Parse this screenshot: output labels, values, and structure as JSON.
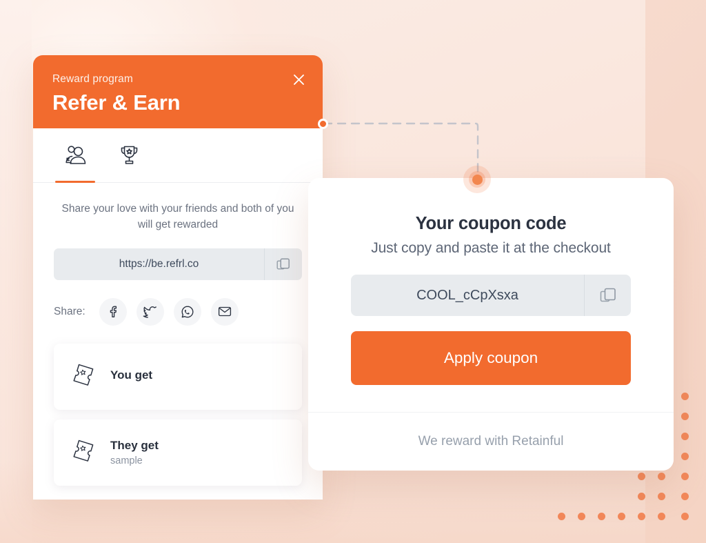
{
  "colors": {
    "brand_orange": "#f26b2e",
    "dot_orange": "#f2885a",
    "bg_peach": "#f8ddd1",
    "text_dark": "#2b3240",
    "text_muted": "#6b7280",
    "field_bg": "#e8ebee"
  },
  "widget": {
    "header": {
      "kicker": "Reward program",
      "title": "Refer & Earn",
      "close_label": "×",
      "close_icon": "close-icon"
    },
    "tabs": [
      {
        "id": "refer",
        "icon": "people-referral-icon",
        "label": "Refer",
        "active": true
      },
      {
        "id": "rewards",
        "icon": "trophy-icon",
        "label": "Rewards",
        "active": false
      }
    ],
    "body": {
      "blurb": "Share your love with your friends and both of you will get rewarded",
      "referral_link": "https://be.refrl.co",
      "copy_icon": "copy-icon",
      "share_label": "Share:",
      "share_options": [
        {
          "id": "facebook",
          "icon": "facebook-icon",
          "label": "Facebook"
        },
        {
          "id": "twitter",
          "icon": "twitter-icon",
          "label": "Twitter"
        },
        {
          "id": "whatsapp",
          "icon": "whatsapp-icon",
          "label": "WhatsApp"
        },
        {
          "id": "email",
          "icon": "email-icon",
          "label": "Email"
        }
      ],
      "rewards": [
        {
          "icon": "ticket-icon",
          "title": "You get",
          "subtitle": ""
        },
        {
          "icon": "ticket-icon",
          "title": "They get",
          "subtitle": "sample"
        }
      ]
    }
  },
  "coupon": {
    "title": "Your coupon code",
    "subtitle": "Just copy and paste it at the checkout",
    "code": "COOL_cCpXsxa",
    "copy_icon": "copy-icon",
    "apply_label": "Apply coupon",
    "footer": "We reward with Retainful"
  }
}
